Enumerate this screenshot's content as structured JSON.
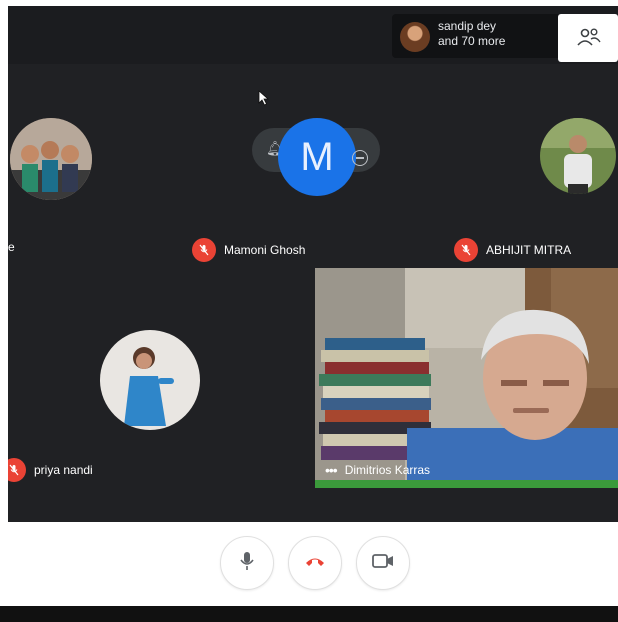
{
  "header": {
    "participant_chip": {
      "line1": "sandip dey",
      "line2": "and 70 more"
    },
    "people_button_icon": "people-icon"
  },
  "tiles": {
    "top_left": {
      "name_fragment": "e"
    },
    "top_center": {
      "avatar_letter": "M",
      "name": "Mamoni Ghosh"
    },
    "top_right": {
      "name": "ABHIJIT MITRA"
    },
    "bottom_left": {
      "name": "priya nandi"
    },
    "video": {
      "name": "Dimitrios Karras"
    }
  },
  "controls": {
    "mic_icon": "microphone-icon",
    "hangup_icon": "hang-up-icon",
    "camera_icon": "camera-icon"
  },
  "colors": {
    "background": "#202124",
    "mute_badge": "#ea4335",
    "avatar_blue": "#1a73e8",
    "hangup_red": "#ea4335"
  }
}
